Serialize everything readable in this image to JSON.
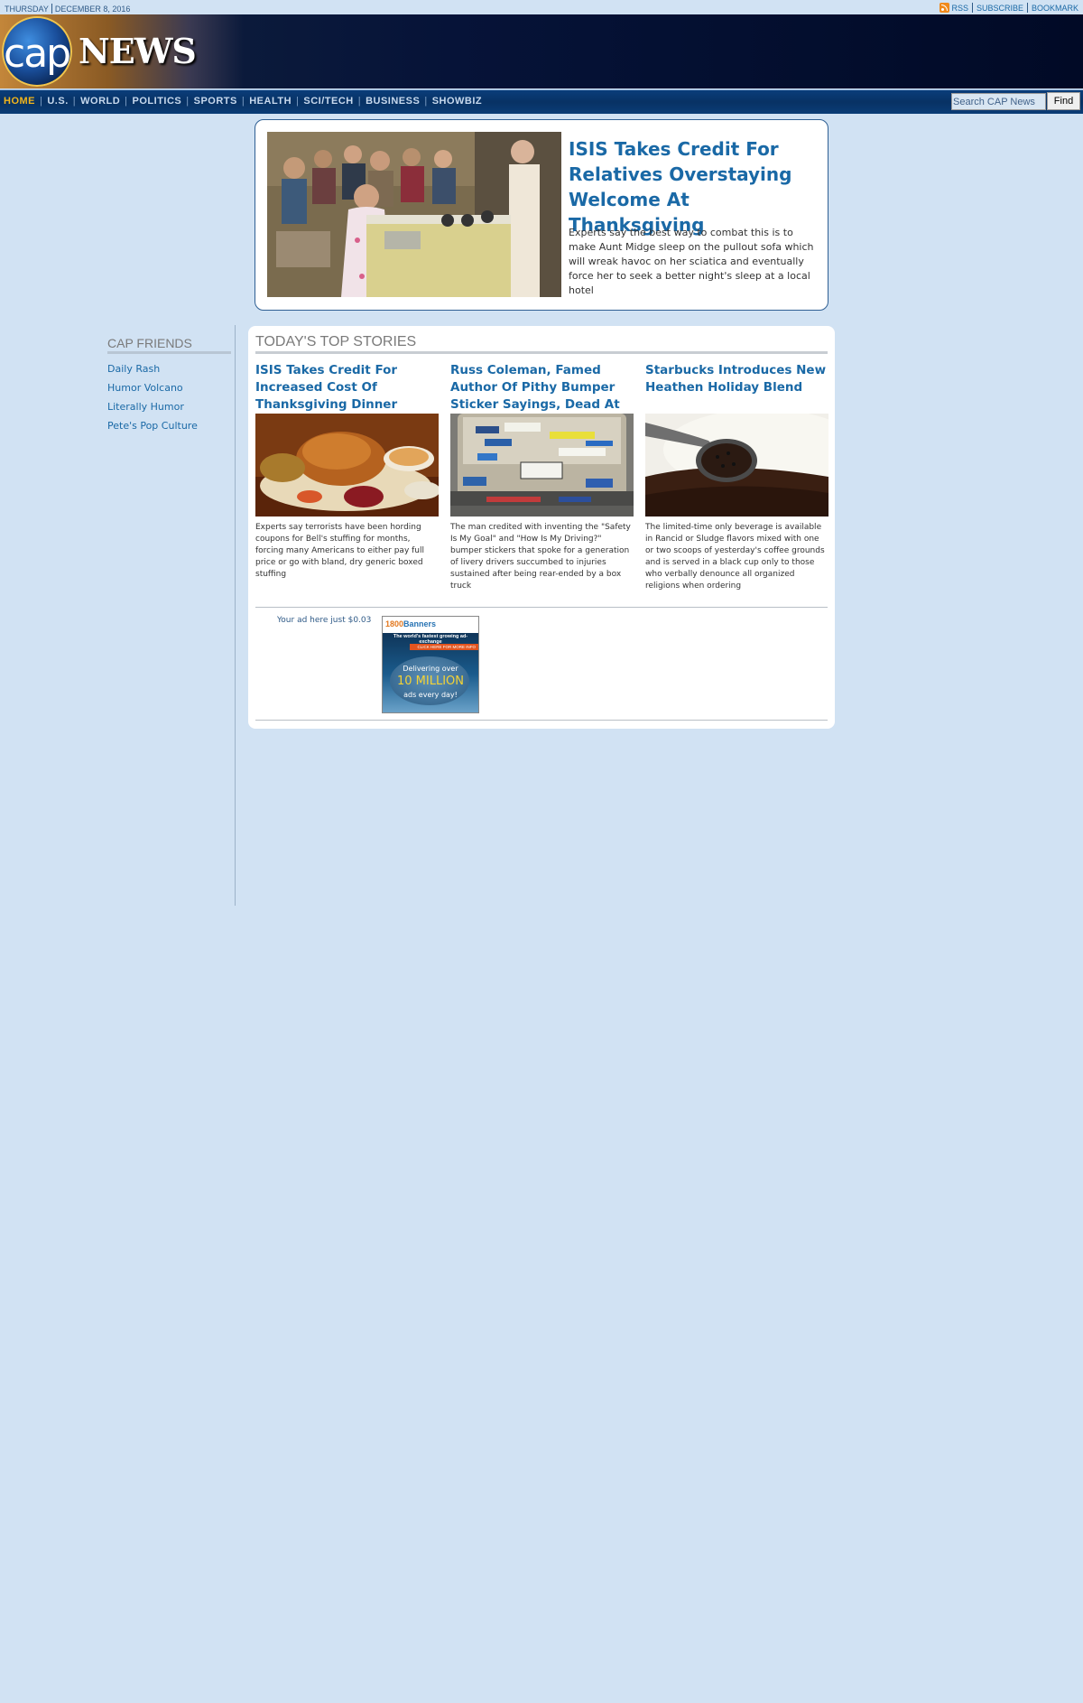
{
  "topbar": {
    "day": "THURSDAY",
    "date": "DECEMBER 8, 2016",
    "links": [
      "RSS",
      "SUBSCRIBE",
      "BOOKMARK"
    ]
  },
  "header": {
    "logo_cap": "cap",
    "logo_news": "NEWS"
  },
  "nav": {
    "items": [
      "HOME",
      "U.S.",
      "WORLD",
      "POLITICS",
      "SPORTS",
      "HEALTH",
      "SCI/TECH",
      "BUSINESS",
      "SHOWBIZ"
    ],
    "active": "HOME",
    "search_value": "Search CAP News",
    "find_label": "Find"
  },
  "hero": {
    "title": "ISIS Takes Credit For Relatives Overstaying Welcome At Thanksgiving",
    "text": "Experts say the best way to combat this is to make Aunt Midge sleep on the pullout sofa which will wreak havoc on her sciatica and eventually force her to seek a better night's sleep at a local hotel"
  },
  "sidebar": {
    "title": "CAP FRIENDS",
    "links": [
      "Daily Rash",
      "Humor Volcano",
      "Literally Humor",
      "Pete's Pop Culture"
    ]
  },
  "top_stories": {
    "title": "TODAY'S TOP STORIES",
    "stories": [
      {
        "title": "ISIS Takes Credit For Increased Cost Of Thanksgiving Dinner",
        "text": "Experts say terrorists have been hording coupons for Bell's stuffing for months, forcing many Americans to either pay full price or go with bland, dry generic boxed stuffing"
      },
      {
        "title": "Russ Coleman, Famed Author Of Pithy Bumper Sticker Sayings, Dead At 83",
        "text": "The man credited with inventing the \"Safety Is My Goal\" and \"How Is My Driving?\" bumper stickers that spoke for a generation of livery drivers succumbed to injuries sustained after being rear-ended by a box truck"
      },
      {
        "title": "Starbucks Introduces New Heathen Holiday Blend",
        "text": "The limited-time only beverage is available in Rancid or Sludge flavors mixed with one or two scoops of yesterday's coffee grounds and is served in a black cup only to those who verbally denounce all organized religions when ordering"
      }
    ]
  },
  "ad": {
    "text": "Your ad here just $0.03",
    "banner": {
      "logo_num": "1800",
      "logo_word": "Banners",
      "tagline": "The world's fastest growing ad-exchange",
      "strip": "CLICK HERE FOR MORE INFO",
      "line1": "Delivering over",
      "line2": "10 MILLION",
      "line3": "ads every day!"
    }
  },
  "colors": {
    "page_bg": "#d1e2f3",
    "link": "#1a69a6",
    "nav_bg": "#083264",
    "nav_active": "#f1b51c"
  }
}
